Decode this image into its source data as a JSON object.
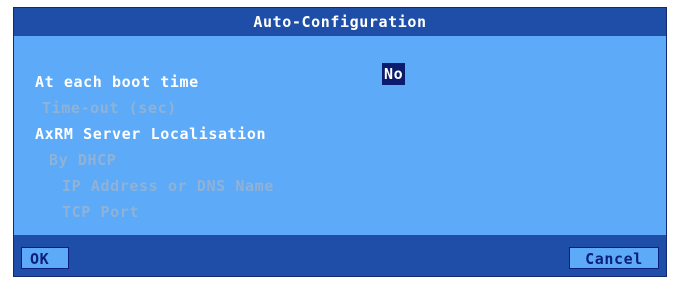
{
  "window": {
    "title": "Auto-Configuration"
  },
  "form": {
    "boot": {
      "label": "At each boot time",
      "value": "No"
    },
    "timeout": {
      "label": "Time-out (sec)"
    },
    "server_section": {
      "label": "AxRM Server Localisation"
    },
    "dhcp": {
      "label": "By DHCP"
    },
    "ip": {
      "label": "IP Address or DNS Name"
    },
    "tcp": {
      "label": "TCP Port"
    }
  },
  "footer": {
    "ok_label": "OK",
    "cancel_label": "Cancel"
  }
}
